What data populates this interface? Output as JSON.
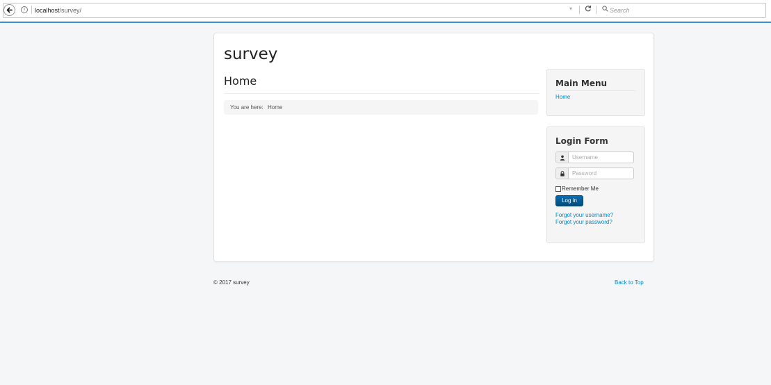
{
  "browser": {
    "url_host": "localhost",
    "url_path": "/survey/",
    "search_placeholder": "Search",
    "info_glyph": "i",
    "reload_glyph": "C",
    "dropdown_glyph": "▾"
  },
  "site": {
    "title": "survey"
  },
  "page": {
    "heading": "Home",
    "breadcrumb": {
      "prefix": "You are here:",
      "current": "Home"
    }
  },
  "main_menu": {
    "title": "Main Menu",
    "items": [
      {
        "label": "Home"
      }
    ]
  },
  "login_form": {
    "title": "Login Form",
    "username_placeholder": "Username",
    "password_placeholder": "Password",
    "remember_label": "Remember Me",
    "login_button": "Log in",
    "forgot_username": "Forgot your username?",
    "forgot_password": "Forgot your password?"
  },
  "footer": {
    "copyright": "© 2017 survey",
    "back_to_top": "Back to Top"
  },
  "colors": {
    "accent_link": "#0088cc",
    "login_button": "#005e8d",
    "chrome_rule": "#3b8fd4",
    "page_background": "#f4f6f7"
  }
}
